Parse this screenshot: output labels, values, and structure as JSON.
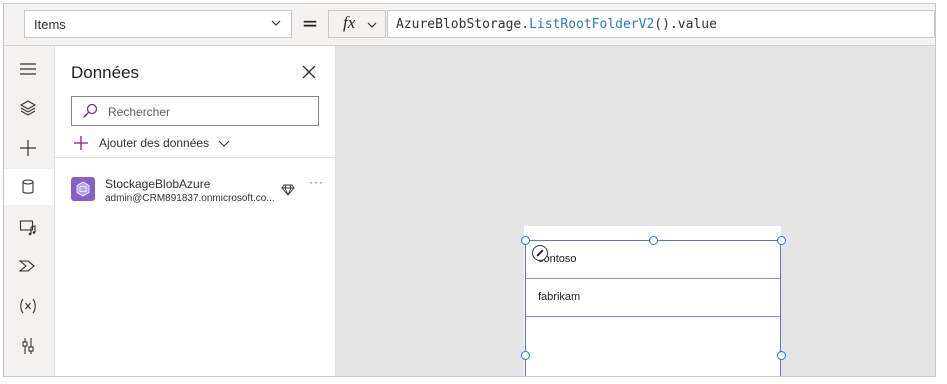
{
  "formula_bar": {
    "property": "Items",
    "equals": "=",
    "fx_label": "fx",
    "formula": {
      "object": "AzureBlobStorage",
      "dot": ".",
      "function": "ListRootFolderV2",
      "rest": "().value"
    }
  },
  "rail": {
    "icons": [
      "hamburger-icon",
      "layers-icon",
      "insert-icon",
      "data-icon",
      "media-icon",
      "power-automate-icon",
      "variables-icon",
      "advanced-tools-icon"
    ],
    "active": "data-icon"
  },
  "data_pane": {
    "title": "Données",
    "search_placeholder": "Rechercher",
    "add_data_label": "Ajouter des données",
    "connections": [
      {
        "name": "StockageBlobAzure",
        "account": "admin@CRM891837.onmicrosoft.co...",
        "more": "···"
      }
    ]
  },
  "canvas": {
    "gallery_items": [
      "contoso",
      "fabrikam"
    ]
  },
  "colors": {
    "accent": "#742774",
    "connector": "#8661c5",
    "selection": "#2f6fd0",
    "canvas_bg": "#e5e5e5"
  }
}
